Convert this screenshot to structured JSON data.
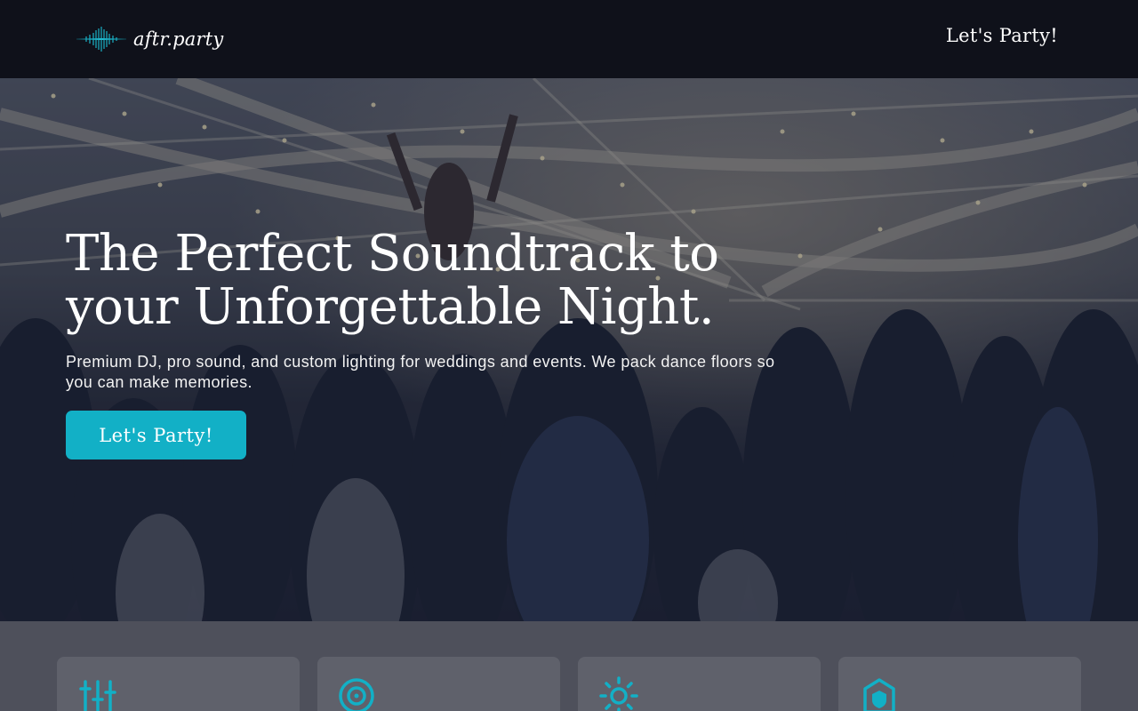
{
  "header": {
    "brand": "aftr.party",
    "nav_cta": "Let's Party!",
    "logo_icon": "sound-wave-icon"
  },
  "hero": {
    "title_line1": "The Perfect Soundtrack to",
    "title_line2": "your Unforgettable Night.",
    "subtitle": "Premium DJ, pro sound, and custom lighting for weddings and events. We pack dance floors so you can make memories.",
    "cta_label": "Let's Party!",
    "background_image": "dance floor party under tent with string lights"
  },
  "features": {
    "cards": [
      {
        "icon": "sliders-icon"
      },
      {
        "icon": "speaker-icon"
      },
      {
        "icon": "sun-icon"
      },
      {
        "icon": "shield-home-icon"
      }
    ]
  },
  "colors": {
    "header_bg": "#0f111a",
    "accent": "#12b0c6",
    "section_bg": "#4e505b",
    "card_bg": "#5f616b"
  }
}
